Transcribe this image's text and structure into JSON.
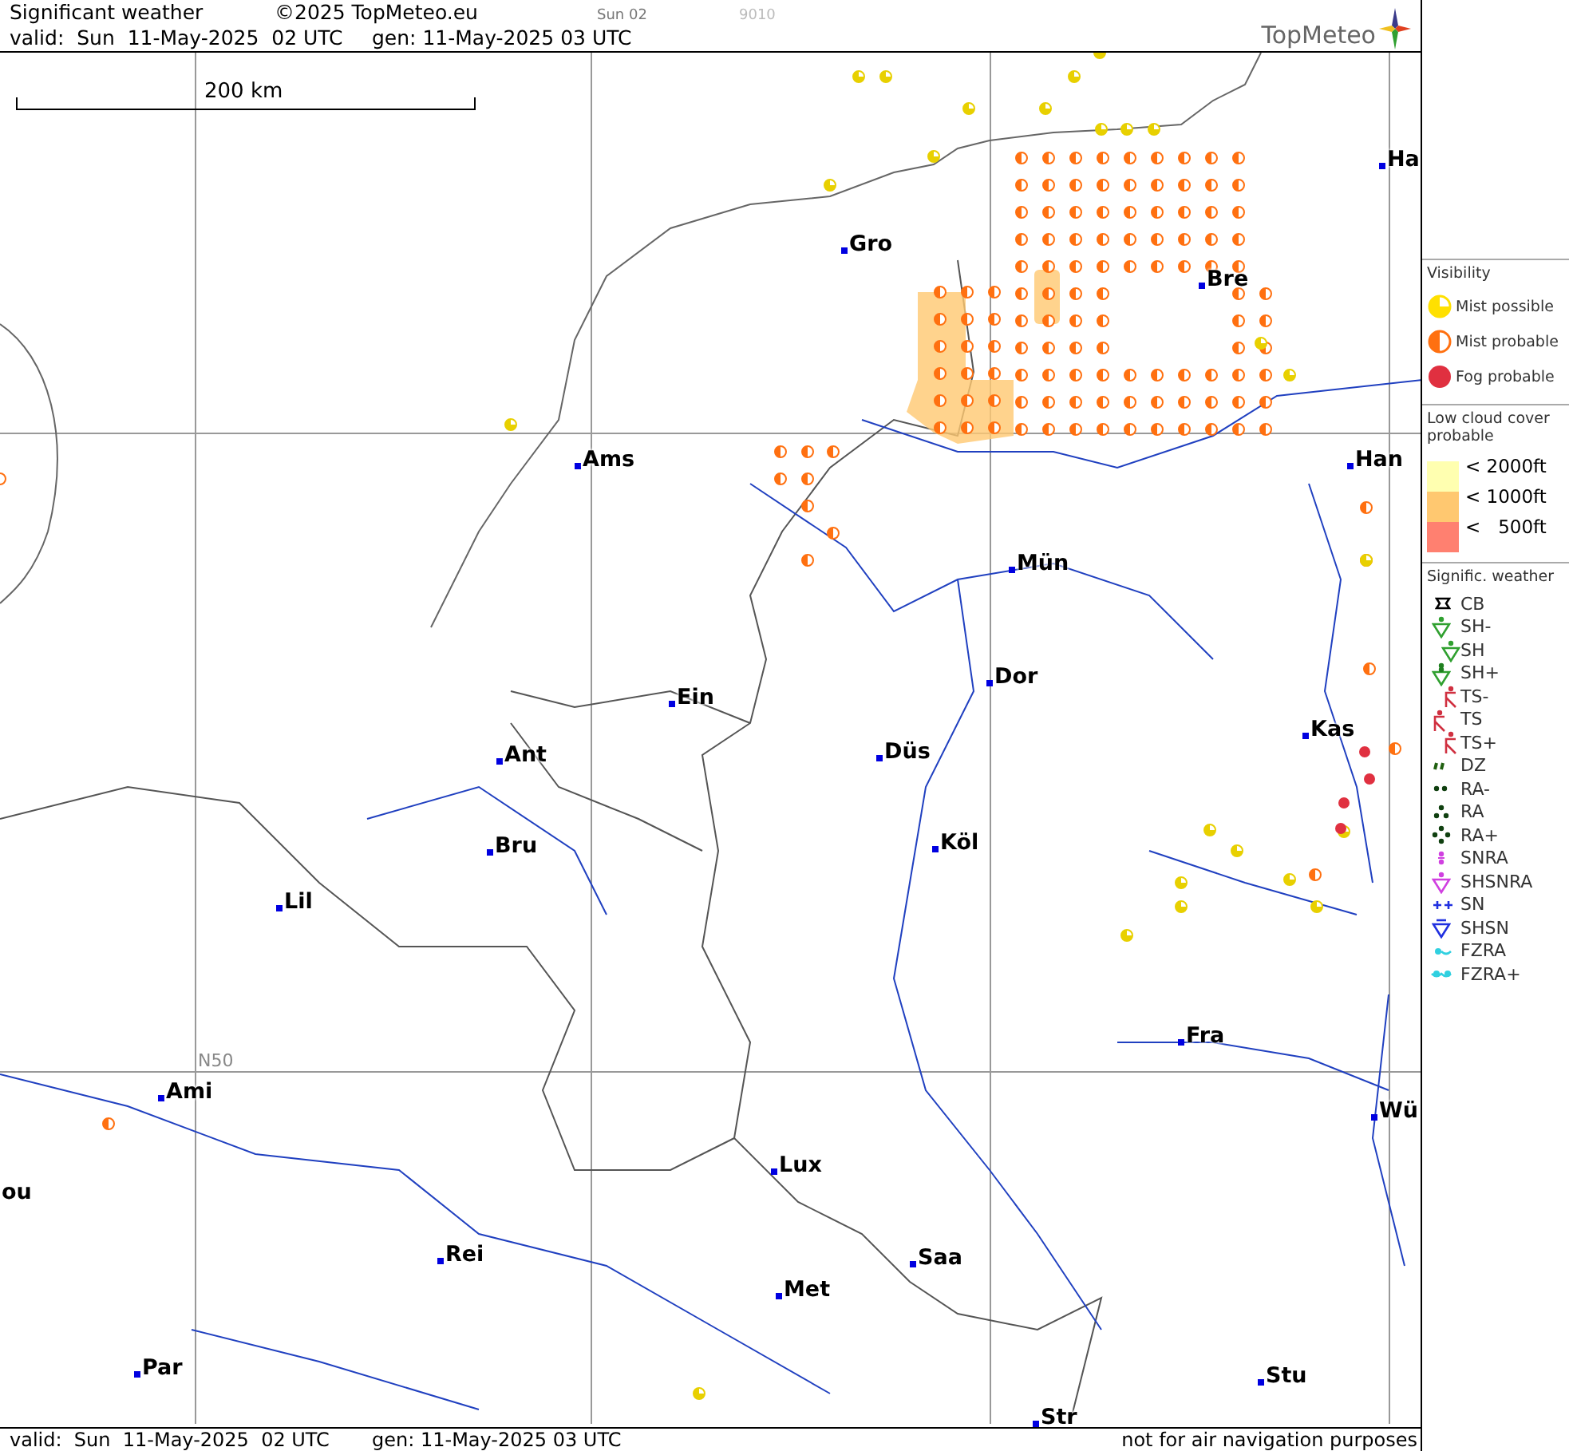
{
  "header": {
    "title": "Significant weather",
    "copyright": "©2025 TopMeteo.eu",
    "run": "Sun 02",
    "code": "9010",
    "valid": "valid:  Sun  11-May-2025  02 UTC",
    "generated": "gen: 11-May-2025 03 UTC",
    "logo": "TopMeteo"
  },
  "map": {
    "scale": "200 km",
    "grid_label": "N50",
    "cities": [
      {
        "name": "Gro"
      },
      {
        "name": "Bre"
      },
      {
        "name": "Ha"
      },
      {
        "name": "Ams"
      },
      {
        "name": "Han"
      },
      {
        "name": "Mün"
      },
      {
        "name": "Ein"
      },
      {
        "name": "Dor"
      },
      {
        "name": "Kas"
      },
      {
        "name": "Ant"
      },
      {
        "name": "Düs"
      },
      {
        "name": "Bru"
      },
      {
        "name": "Köl"
      },
      {
        "name": "Lil"
      },
      {
        "name": "Fra"
      },
      {
        "name": "Ami"
      },
      {
        "name": "Wü"
      },
      {
        "name": "Lux"
      },
      {
        "name": "ou"
      },
      {
        "name": "Rei"
      },
      {
        "name": "Saa"
      },
      {
        "name": "Met"
      },
      {
        "name": "Par"
      },
      {
        "name": "Stu"
      },
      {
        "name": "Str"
      }
    ]
  },
  "footer": {
    "valid": "valid:  Sun  11-May-2025  02 UTC",
    "generated": "gen: 11-May-2025 03 UTC",
    "note": "not for air navigation purposes"
  },
  "legend": {
    "visibility": {
      "title": "Visibility",
      "items": [
        {
          "kind": "mist-possible",
          "label": "Mist possible"
        },
        {
          "kind": "mist-probable",
          "label": "Mist probable"
        },
        {
          "kind": "fog-probable",
          "label": "Fog probable"
        }
      ]
    },
    "low_cloud": {
      "title": "Low cloud cover probable",
      "items": [
        {
          "label": "< 2000ft",
          "color": "#ffffb0"
        },
        {
          "label": "< 1000ft",
          "color": "#ffc870"
        },
        {
          "label": "<   500ft",
          "color": "#ff8070"
        }
      ]
    },
    "weather": {
      "title": "Signific. weather",
      "items": [
        {
          "kind": "cb",
          "label": "CB"
        },
        {
          "kind": "sh-light",
          "label": "SH-"
        },
        {
          "kind": "sh",
          "label": "SH"
        },
        {
          "kind": "sh-heavy",
          "label": "SH+"
        },
        {
          "kind": "ts-light",
          "label": "TS-"
        },
        {
          "kind": "ts",
          "label": "TS"
        },
        {
          "kind": "ts-heavy",
          "label": "TS+"
        },
        {
          "kind": "dz",
          "label": "DZ"
        },
        {
          "kind": "ra-light",
          "label": "RA-"
        },
        {
          "kind": "ra",
          "label": "RA"
        },
        {
          "kind": "ra-heavy",
          "label": "RA+"
        },
        {
          "kind": "snra",
          "label": "SNRA"
        },
        {
          "kind": "shsnra",
          "label": "SHSNRA"
        },
        {
          "kind": "sn",
          "label": "SN"
        },
        {
          "kind": "shsn",
          "label": "SHSN"
        },
        {
          "kind": "fzra",
          "label": "FZRA"
        },
        {
          "kind": "fzra-heavy",
          "label": "FZRA+"
        }
      ]
    }
  }
}
